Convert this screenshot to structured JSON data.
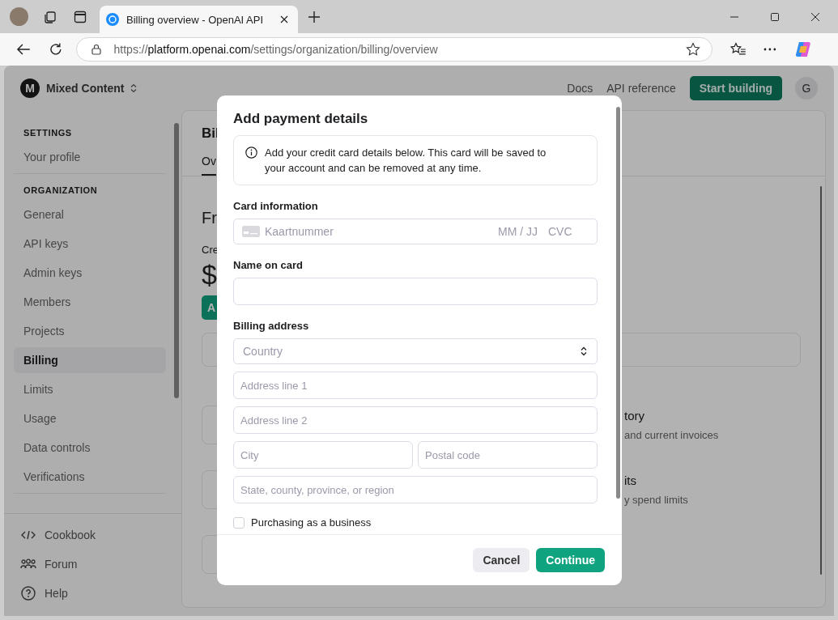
{
  "browser": {
    "tab": {
      "title": "Billing overview - OpenAI API"
    },
    "address": {
      "scheme": "https://",
      "host": "platform.openai.com",
      "path": "/settings/organization/billing/overview"
    }
  },
  "header": {
    "org_initial": "M",
    "org_name": "Mixed Content",
    "links": [
      "Docs",
      "API reference"
    ],
    "cta": "Start building",
    "user_initial": "G"
  },
  "sidebar": {
    "sections": [
      {
        "title": "SETTINGS",
        "items": [
          {
            "label": "Your profile",
            "selected": false
          }
        ]
      },
      {
        "title": "ORGANIZATION",
        "items": [
          {
            "label": "General",
            "selected": false
          },
          {
            "label": "API keys",
            "selected": false
          },
          {
            "label": "Admin keys",
            "selected": false
          },
          {
            "label": "Members",
            "selected": false
          },
          {
            "label": "Projects",
            "selected": false
          },
          {
            "label": "Billing",
            "selected": true
          },
          {
            "label": "Limits",
            "selected": false
          },
          {
            "label": "Usage",
            "selected": false
          },
          {
            "label": "Data controls",
            "selected": false
          },
          {
            "label": "Verifications",
            "selected": false
          }
        ]
      }
    ],
    "footer": [
      {
        "kind": "code",
        "label": "Cookbook"
      },
      {
        "kind": "people",
        "label": "Forum"
      },
      {
        "kind": "help",
        "label": "Help"
      }
    ]
  },
  "main": {
    "title": "Bil",
    "tab": "Ov",
    "heading": "Fr",
    "credit_label": "Cre",
    "amount": "$",
    "button": "A",
    "cards": [
      {
        "title": "tory",
        "subtitle": "and current invoices"
      },
      {
        "title": "its",
        "subtitle": "y spend limits"
      }
    ]
  },
  "dialog": {
    "title": "Add payment details",
    "info": "Add your credit card details below. This card will be saved to your account and can be removed at any time.",
    "card_label": "Card information",
    "card_number_placeholder": "Kaartnummer",
    "expiry_placeholder": "MM / JJ",
    "cvc_placeholder": "CVC",
    "name_label": "Name on card",
    "address_label": "Billing address",
    "country": "Country",
    "address_fields": [
      {
        "kind": "full",
        "placeholder": "Address line 1"
      },
      {
        "kind": "full",
        "placeholder": "Address line 2"
      },
      {
        "kind": "half",
        "placeholder": "City"
      },
      {
        "kind": "half",
        "placeholder": "Postal code"
      },
      {
        "kind": "full",
        "placeholder": "State, county, province, or region"
      }
    ],
    "business": {
      "label": "Purchasing as a business",
      "checked": false
    },
    "buttons": [
      {
        "kind": "secondary",
        "label": "Cancel"
      },
      {
        "kind": "primary",
        "label": "Continue"
      }
    ]
  }
}
